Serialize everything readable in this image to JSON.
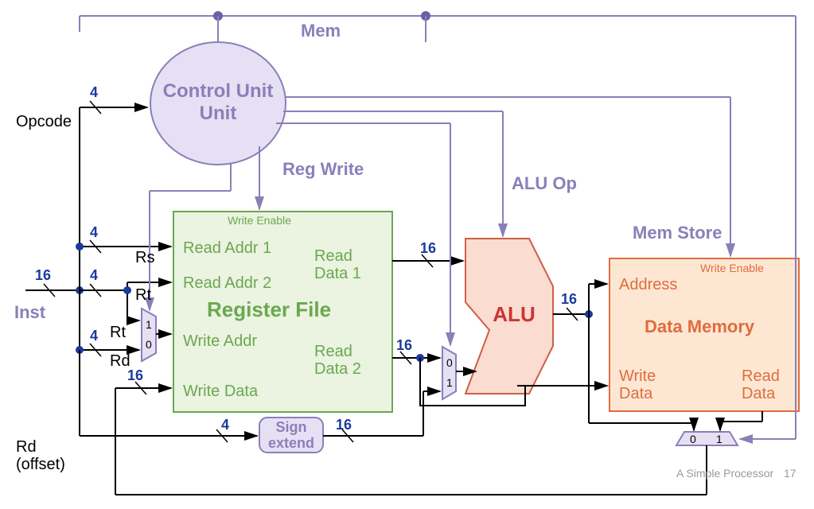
{
  "control_unit": {
    "title": "Control Unit"
  },
  "signals": {
    "mem": "Mem",
    "reg_write": "Reg Write",
    "alu_op": "ALU Op",
    "mem_store": "Mem Store",
    "opcode": "Opcode",
    "inst": "Inst",
    "rs": "Rs",
    "rt": "Rt",
    "rd": "Rd",
    "rd_offset_line1": "Rd",
    "rd_offset_line2": "(offset)",
    "write_enable_reg": "Write Enable",
    "write_enable_mem": "Write Enable"
  },
  "widths": {
    "opcode": "4",
    "rs": "4",
    "rt": "4",
    "rd": "4",
    "inst": "16",
    "writedata": "16",
    "sign_in": "4",
    "sign_out": "16",
    "alu_in1": "16",
    "alu_in2": "16",
    "alu_out": "16"
  },
  "register_file": {
    "title": "Register File",
    "read_addr1": "Read Addr 1",
    "read_addr2": "Read Addr 2",
    "write_addr": "Write Addr",
    "write_data": "Write Data",
    "read_data1": "Read Data 1",
    "read_data2": "Read Data 2"
  },
  "alu": {
    "title": "ALU"
  },
  "data_memory": {
    "title": "Data Memory",
    "address": "Address",
    "write_data": "Write Data",
    "read_data": "Read Data"
  },
  "sign_extend": {
    "title_line": "Sign extend"
  },
  "mux": {
    "addr1": "1",
    "addr0": "0",
    "alu0": "0",
    "alu1": "1",
    "mem0": "0",
    "mem1": "1"
  },
  "footer": {
    "text": "A Simple Processor",
    "page": "17"
  }
}
